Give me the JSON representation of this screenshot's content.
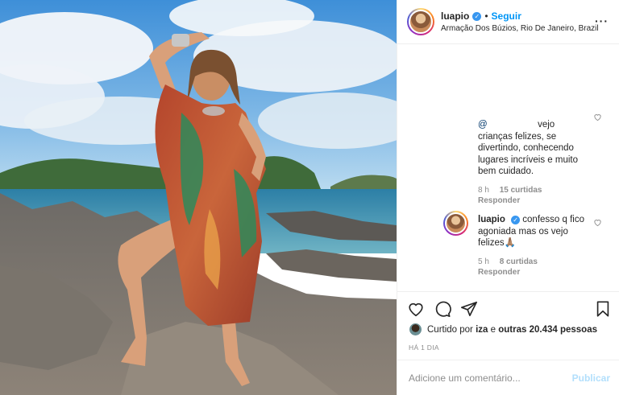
{
  "header": {
    "username": "luapio",
    "verified_mark": "✓",
    "separator": "•",
    "follow_label": "Seguir",
    "location": "Armação Dos Búzios, Rio De Janeiro, Brazil",
    "more_label": "···"
  },
  "comments": [
    {
      "mention": "@",
      "text": "vejo crianças felizes, se divertindo, conhecendo lugares incríveis e muito bem cuidado.",
      "time": "8 h",
      "likes": "15 curtidas",
      "reply": "Responder"
    },
    {
      "username": "luapio",
      "text": "confesso q fico agoniada mas os vejo felizes🙏🏽",
      "time": "5 h",
      "likes": "8 curtidas",
      "reply": "Responder"
    }
  ],
  "likes_row": {
    "prefix": "Curtido por",
    "user": "iza",
    "conj": "e",
    "others": "outras 20.434 pessoas"
  },
  "posted_ago": "HÁ 1 DIA",
  "comment_input": {
    "placeholder": "Adicione um comentário...",
    "publish_label": "Publicar"
  },
  "icons": [
    "heart-icon",
    "comment-icon",
    "share-icon",
    "bookmark-icon",
    "verified-icon",
    "more-icon"
  ],
  "colors": {
    "accent": "#0095f6",
    "verified": "#3897f0",
    "publish_disabled": "#b2dffc",
    "muted": "#8e8e8e"
  }
}
